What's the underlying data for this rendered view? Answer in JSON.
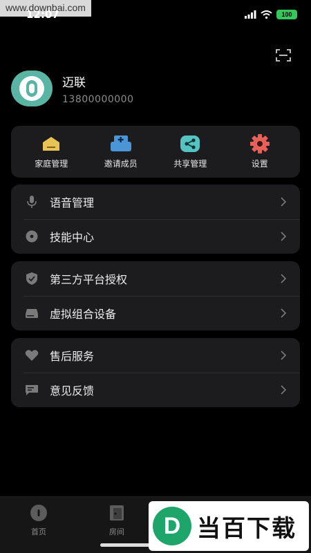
{
  "status_bar": {
    "time": "12:07",
    "battery": "100",
    "watermark_url": "www.downbai.com"
  },
  "profile": {
    "name": "迈联",
    "phone": "13800000000"
  },
  "quick_actions": [
    {
      "label": "家庭管理",
      "icon": "house-icon",
      "color": "#e7c255"
    },
    {
      "label": "邀请成员",
      "icon": "invite-member-icon",
      "color": "#4a95d6"
    },
    {
      "label": "共享管理",
      "icon": "share-icon",
      "color": "#56c3c3"
    },
    {
      "label": "设置",
      "icon": "gear-icon",
      "color": "#e7605a"
    }
  ],
  "menu_groups": [
    [
      {
        "label": "语音管理",
        "icon": "microphone-icon"
      },
      {
        "label": "技能中心",
        "icon": "skill-center-icon"
      }
    ],
    [
      {
        "label": "第三方平台授权",
        "icon": "shield-check-icon"
      },
      {
        "label": "虚拟组合设备",
        "icon": "device-icon"
      }
    ],
    [
      {
        "label": "售后服务",
        "icon": "heart-hand-icon"
      },
      {
        "label": "意见反馈",
        "icon": "feedback-icon"
      }
    ]
  ],
  "tabs": [
    {
      "label": "首页",
      "icon": "home-tab-icon"
    },
    {
      "label": "房间",
      "icon": "room-tab-icon"
    }
  ],
  "watermark_badge": {
    "logo_letter": "D",
    "text": "当百下载"
  }
}
